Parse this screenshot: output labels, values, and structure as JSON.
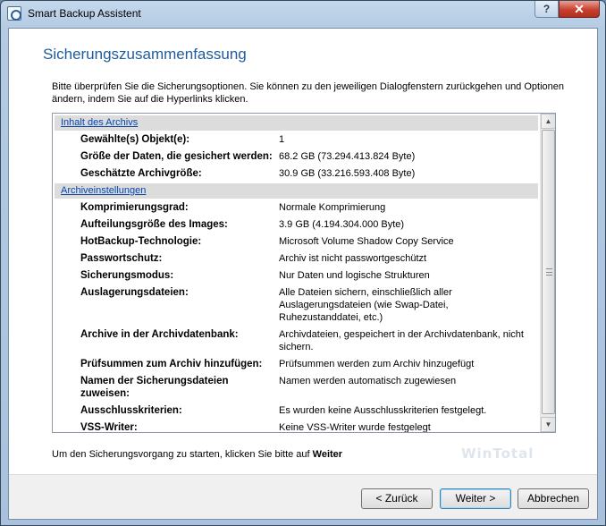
{
  "window": {
    "title": "Smart Backup Assistent",
    "help_label": "?",
    "close_label": "✕"
  },
  "page": {
    "title": "Sicherungszusammenfassung",
    "intro": "Bitte überprüfen Sie die Sicherungsoptionen. Sie können zu den jeweiligen Dialogfenstern zurückgehen und Optionen ändern, indem Sie auf die Hyperlinks klicken."
  },
  "sections": [
    {
      "title": "Inhalt des Archivs",
      "rows": [
        {
          "key": "Gewählte(s) Objekt(e):",
          "value": "1"
        },
        {
          "key": "Größe der Daten, die gesichert werden:",
          "value": "68.2 GB (73.294.413.824 Byte)"
        },
        {
          "key": "Geschätzte Archivgröße:",
          "value": "30.9 GB (33.216.593.408 Byte)"
        }
      ]
    },
    {
      "title": "Archiveinstellungen",
      "rows": [
        {
          "key": "Komprimierungsgrad:",
          "value": "Normale Komprimierung"
        },
        {
          "key": "Aufteilungsgröße des Images:",
          "value": "3.9 GB (4.194.304.000 Byte)"
        },
        {
          "key": "HotBackup-Technologie:",
          "value": "Microsoft Volume Shadow Copy Service"
        },
        {
          "key": "Passwortschutz:",
          "value": "Archiv ist nicht passwortgeschützt"
        },
        {
          "key": "Sicherungsmodus:",
          "value": "Nur Daten und logische Strukturen"
        },
        {
          "key": "Auslagerungsdateien:",
          "value": "Alle Dateien sichern, einschließlich aller Auslagerungsdateien (wie Swap-Datei, Ruhezustanddatei, etc.)"
        },
        {
          "key": "Archive in der Archivdatenbank:",
          "value": "Archivdateien, gespeichert in der Archivdatenbank, nicht sichern."
        },
        {
          "key": "Prüfsummen zum Archiv hinzufügen:",
          "value": "Prüfsummen werden zum Archiv hinzugefügt"
        },
        {
          "key": "Namen der Sicherungsdateien zuweisen:",
          "value": "Namen werden automatisch zugewiesen"
        },
        {
          "key": "Ausschlusskriterien:",
          "value": "Es wurden keine Ausschlusskriterien festgelegt."
        },
        {
          "key": "VSS-Writer:",
          "value": "Keine VSS-Writer wurde festgelegt"
        }
      ]
    }
  ],
  "footer": {
    "text_before": "Um den Sicherungsvorgang zu starten, klicken Sie bitte auf ",
    "text_bold": "Weiter"
  },
  "watermark": "WinTotal",
  "buttons": {
    "back": "< Zurück",
    "next": "Weiter >",
    "cancel": "Abbrechen"
  }
}
